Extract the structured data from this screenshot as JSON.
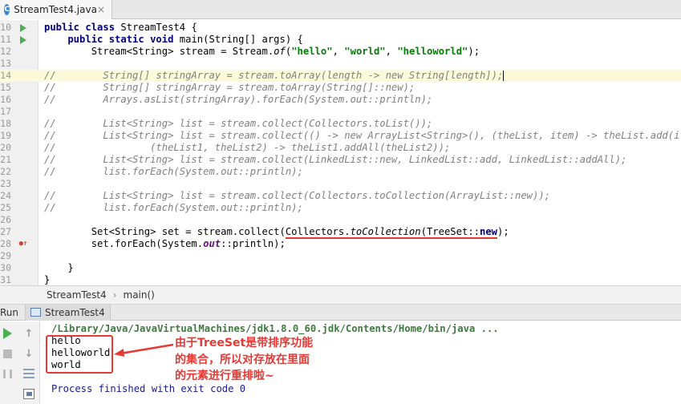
{
  "tab": {
    "icon_letter": "C",
    "filename": "StreamTest4.java",
    "close_glyph": "×"
  },
  "editor": {
    "lines": [
      {
        "num": "10",
        "mark": "run",
        "segments": [
          {
            "t": "public class ",
            "c": "kw"
          },
          {
            "t": "StreamTest4 {",
            "c": ""
          }
        ]
      },
      {
        "num": "11",
        "mark": "run",
        "segments": [
          {
            "t": "    public static void ",
            "c": "kw"
          },
          {
            "t": "main(String[] args) {",
            "c": ""
          }
        ]
      },
      {
        "num": "12",
        "segments": [
          {
            "t": "        Stream<String> stream = Stream.",
            "c": ""
          },
          {
            "t": "of",
            "c": "itl"
          },
          {
            "t": "(",
            "c": ""
          },
          {
            "t": "\"hello\"",
            "c": "str"
          },
          {
            "t": ", ",
            "c": ""
          },
          {
            "t": "\"world\"",
            "c": "str"
          },
          {
            "t": ", ",
            "c": ""
          },
          {
            "t": "\"helloworld\"",
            "c": "str"
          },
          {
            "t": ");",
            "c": ""
          }
        ]
      },
      {
        "num": "13",
        "segments": []
      },
      {
        "num": "14",
        "current": true,
        "caret": true,
        "segments": [
          {
            "t": "//        String[] stringArray = stream.toArray(length -> new String[length]);",
            "c": "cm"
          }
        ]
      },
      {
        "num": "15",
        "segments": [
          {
            "t": "//        String[] stringArray = stream.toArray(String[]::new);",
            "c": "cm"
          }
        ]
      },
      {
        "num": "16",
        "segments": [
          {
            "t": "//        Arrays.asList(stringArray).forEach(System.out::println);",
            "c": "cm"
          }
        ]
      },
      {
        "num": "17",
        "segments": []
      },
      {
        "num": "18",
        "segments": [
          {
            "t": "//        List<String> list = stream.collect(Collectors.toList());",
            "c": "cm"
          }
        ]
      },
      {
        "num": "19",
        "segments": [
          {
            "t": "//        List<String> list = stream.collect(() -> new ArrayList<String>(), (theList, item) -> theList.add(item),",
            "c": "cm"
          }
        ]
      },
      {
        "num": "20",
        "segments": [
          {
            "t": "//                (theList1, theList2) -> theList1.addAll(theList2));",
            "c": "cm"
          }
        ]
      },
      {
        "num": "21",
        "segments": [
          {
            "t": "//        List<String> list = stream.collect(LinkedList::new, LinkedList::add, LinkedList::addAll);",
            "c": "cm"
          }
        ]
      },
      {
        "num": "22",
        "segments": [
          {
            "t": "//        list.forEach(System.out::println);",
            "c": "cm"
          }
        ]
      },
      {
        "num": "23",
        "segments": []
      },
      {
        "num": "24",
        "segments": [
          {
            "t": "//        List<String> list = stream.collect(Collectors.toCollection(ArrayList::new));",
            "c": "cm"
          }
        ]
      },
      {
        "num": "25",
        "segments": [
          {
            "t": "//        list.forEach(System.out::println);",
            "c": "cm"
          }
        ]
      },
      {
        "num": "26",
        "segments": []
      },
      {
        "num": "27",
        "segments": [
          {
            "t": "        Set<String> set = stream.collect(",
            "c": ""
          },
          {
            "t": "Collectors.",
            "c": "",
            "u": true
          },
          {
            "t": "toCollection",
            "c": "itl",
            "u": true
          },
          {
            "t": "(TreeSet::",
            "c": "",
            "u": true
          },
          {
            "t": "new",
            "c": "kw",
            "u": true
          },
          {
            "t": ");",
            "c": ""
          }
        ]
      },
      {
        "num": "28",
        "mark": "breakpoint",
        "segments": [
          {
            "t": "        set.forEach(System.",
            "c": ""
          },
          {
            "t": "out",
            "c": "fld"
          },
          {
            "t": "::println);",
            "c": ""
          }
        ]
      },
      {
        "num": "29",
        "segments": []
      },
      {
        "num": "30",
        "segments": [
          {
            "t": "    }",
            "c": ""
          }
        ]
      },
      {
        "num": "31",
        "segments": [
          {
            "t": "}",
            "c": ""
          }
        ]
      }
    ]
  },
  "breadcrumb": {
    "items": [
      "StreamTest4",
      "main()"
    ],
    "separator": "›"
  },
  "run_panel": {
    "label": "Run",
    "tab_label": "StreamTest4",
    "console_lines": [
      {
        "text": "/Library/Java/JavaVirtualMachines/jdk1.8.0_60.jdk/Contents/Home/bin/java ...",
        "kind": "path"
      },
      {
        "text": "hello",
        "kind": "out"
      },
      {
        "text": "helloworld",
        "kind": "out"
      },
      {
        "text": "world",
        "kind": "out"
      },
      {
        "text": "",
        "kind": "out"
      },
      {
        "text": "Process finished with exit code 0",
        "kind": "proc"
      }
    ]
  },
  "annotation": {
    "text": "由于TreeSet是带排序功能的集合，所以对存放在里面的元素进行重排啦~",
    "color": "#e53935"
  },
  "colors": {
    "keyword": "#000080",
    "string": "#008000",
    "comment": "#808080",
    "annotation_red": "#e53935",
    "run_green": "#4caf50"
  }
}
